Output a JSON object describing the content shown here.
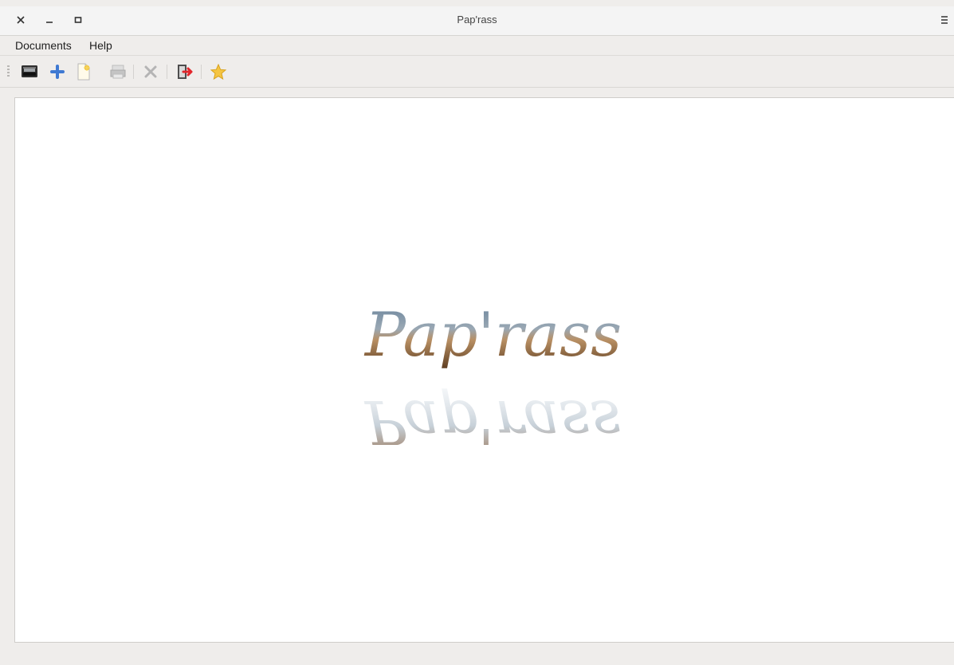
{
  "window": {
    "title": "Pap'rass",
    "controls": {
      "close_icon": "close-icon",
      "minimize_icon": "minimize-icon",
      "maximize_icon": "maximize-icon",
      "menu_icon": "hamburger-menu-icon"
    }
  },
  "menubar": {
    "items": [
      {
        "label": "Documents"
      },
      {
        "label": "Help"
      }
    ]
  },
  "toolbar": {
    "buttons": [
      {
        "icon": "scanner-icon",
        "enabled": true
      },
      {
        "icon": "add-icon",
        "enabled": true
      },
      {
        "icon": "new-document-icon",
        "enabled": true
      },
      {
        "icon": "print-icon",
        "enabled": false
      },
      {
        "icon": "delete-icon",
        "enabled": false
      },
      {
        "icon": "exit-icon",
        "enabled": true
      },
      {
        "icon": "star-icon",
        "enabled": true
      }
    ]
  },
  "content": {
    "logo_text": "Pap'rass",
    "colors": {
      "logo_top": "#6f8ea8",
      "logo_mid": "#b78b5d",
      "logo_bottom": "#5b3a1f"
    }
  }
}
